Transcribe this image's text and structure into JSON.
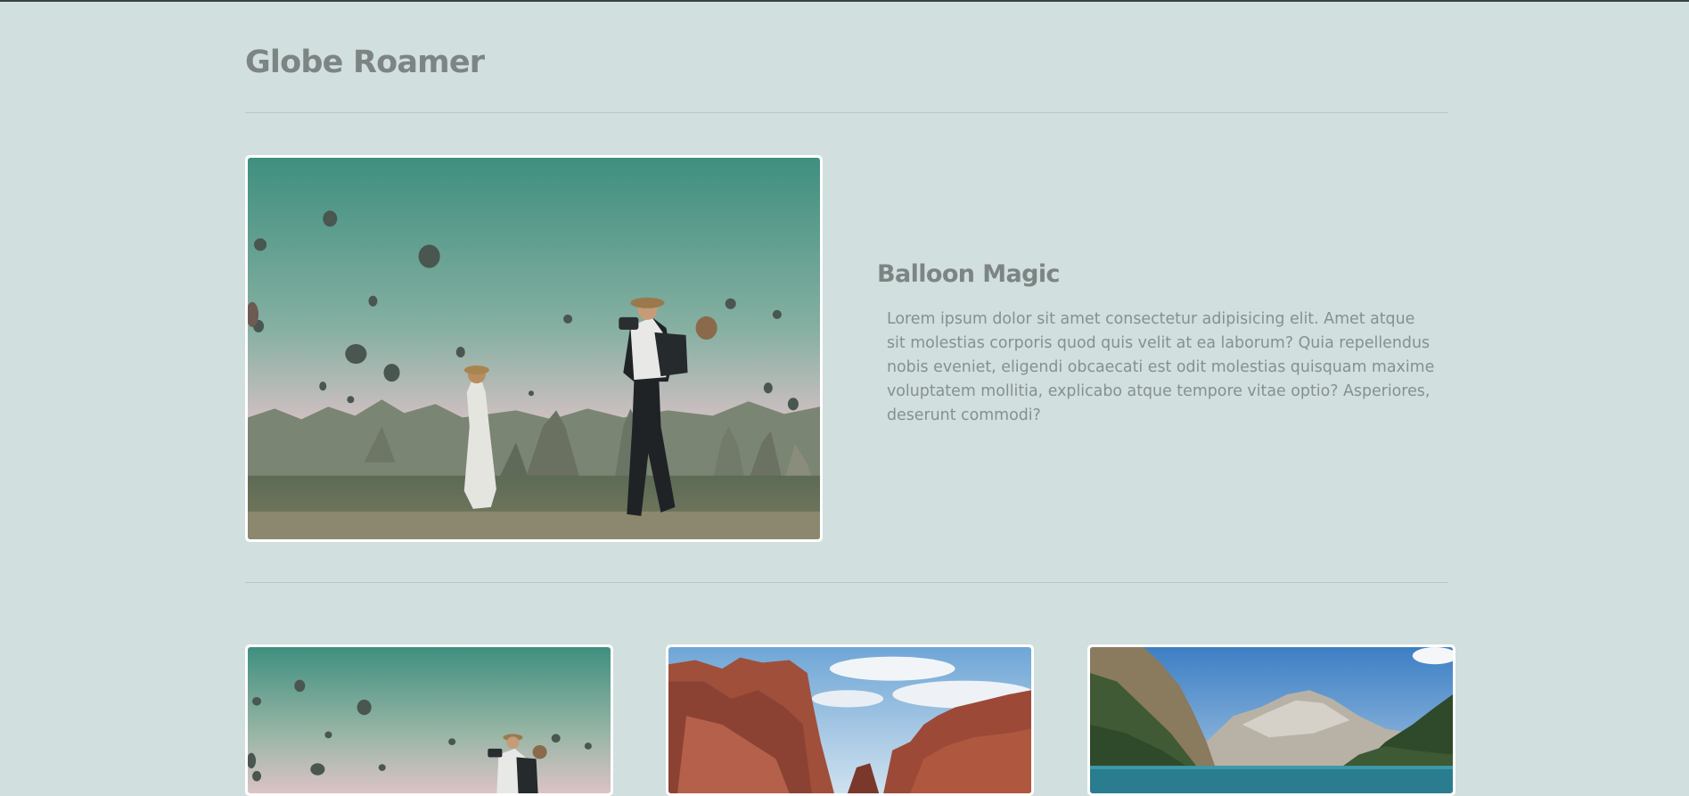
{
  "site": {
    "title": "Globe Roamer"
  },
  "feature": {
    "image_label": "Travelers photographing hot air balloons",
    "title": "Balloon Magic",
    "body": "Lorem ipsum dolor sit amet consectetur adipisicing elit. Amet atque sit molestias corporis quod quis velit at ea laborum? Quia repellendus nobis eveniet, eligendi obcaecati est odit molestias quisquam maxime voluptatem mollitia, explicabo atque tempore vitae optio? Asperiores, deserunt commodi?"
  },
  "cards": [
    {
      "image_label": "Hot air balloons over valley"
    },
    {
      "image_label": "Red rock canyon"
    },
    {
      "image_label": "Mountain lake"
    }
  ],
  "colors": {
    "background": "#d1dfde",
    "heading": "#7c8583",
    "body_text": "#86918f",
    "divider": "#b8c6c5",
    "frame": "#ffffff"
  }
}
